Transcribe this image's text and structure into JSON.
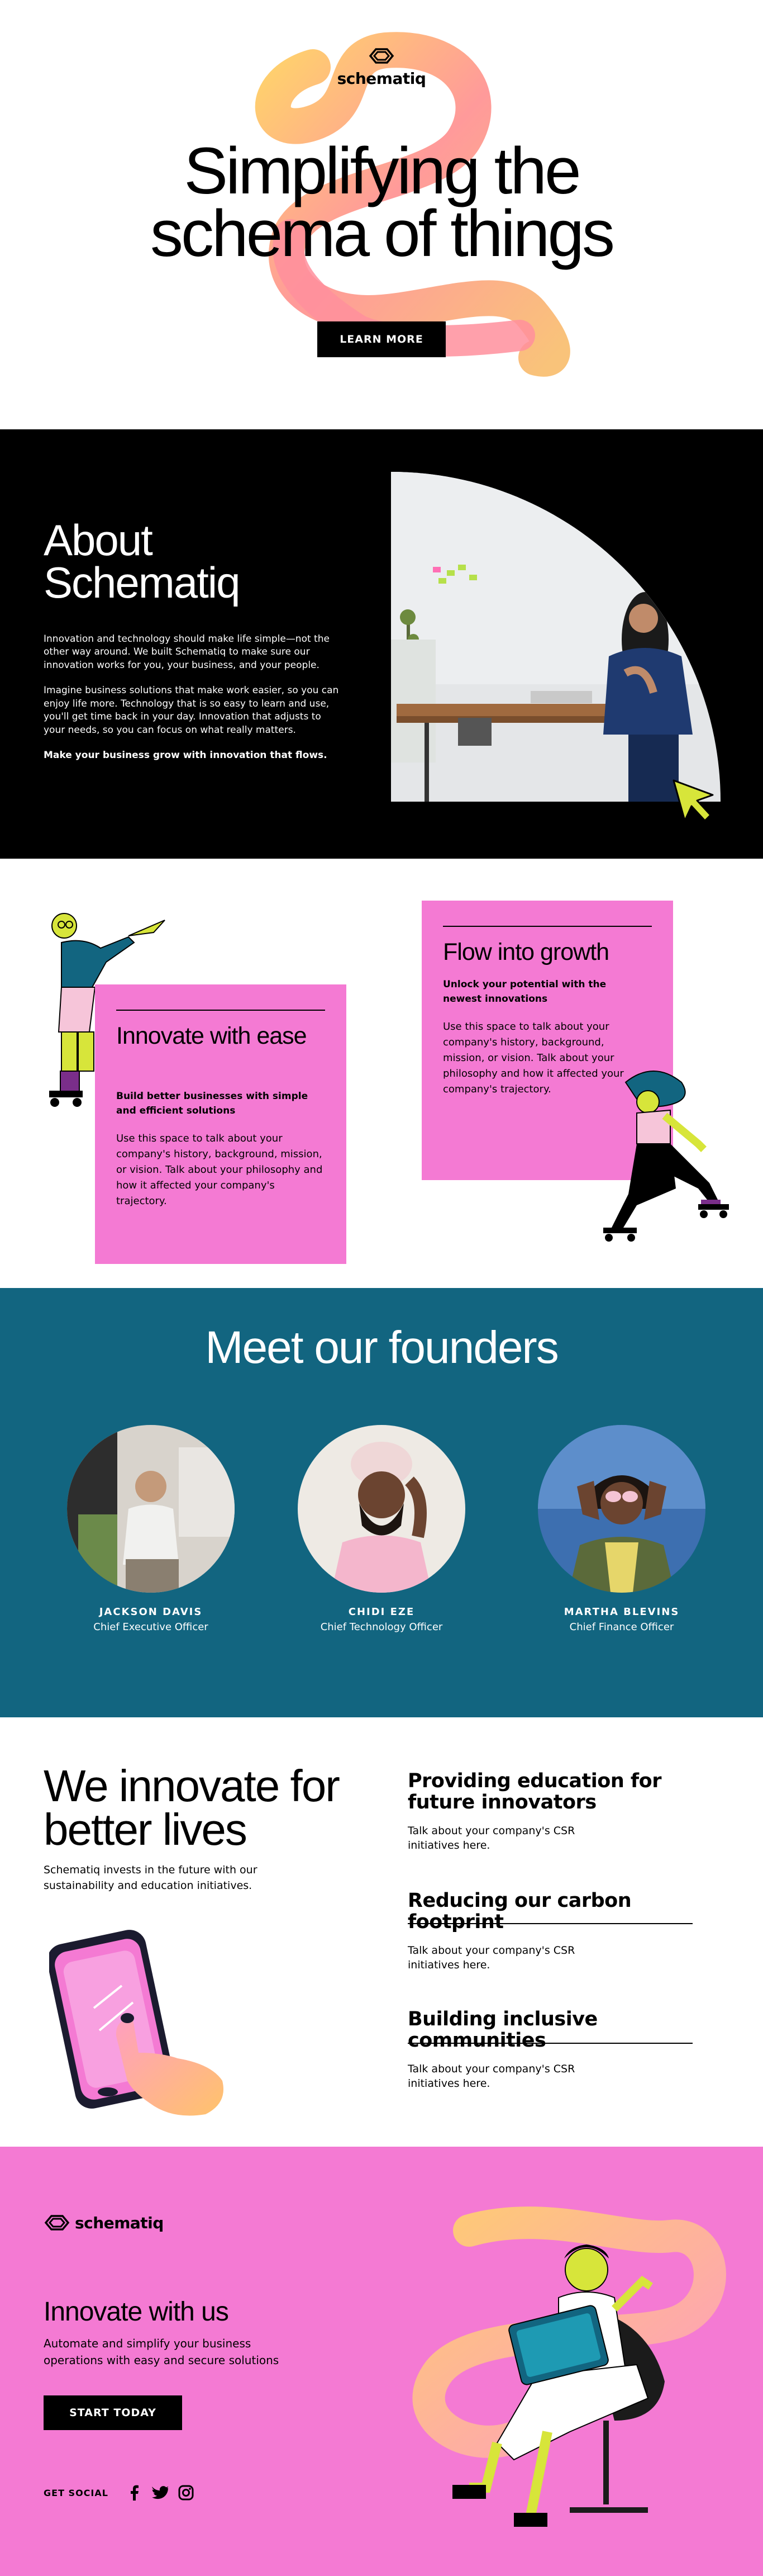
{
  "brand": {
    "name": "schematiq"
  },
  "hero": {
    "title_line1": "Simplifying the",
    "title_line2": "schema of things",
    "cta_label": "LEARN MORE"
  },
  "about": {
    "title": "About Schematiq",
    "paragraph1": "Innovation and technology should make life simple—not the other way around. We built Schematiq to make sure our innovation works for you, your business, and your people.",
    "paragraph2": "Imagine business solutions that make work easier, so you can enjoy life more. Technology that is so easy to learn and use, you'll get time back in your day. Innovation that adjusts to your needs, so you can focus on what really matters.",
    "paragraph3": "Make your business grow with innovation that flows."
  },
  "cards": [
    {
      "title": "Innovate with ease",
      "subtitle": "Build better businesses with simple and efficient solutions",
      "body": "Use this space to talk about your company's history, background, mission, or vision. Talk about your philosophy and how it affected your company's trajectory."
    },
    {
      "title": "Flow into growth",
      "subtitle": "Unlock your potential with the newest innovations",
      "body": "Use this space to talk about your company's history, background, mission, or vision. Talk about your philosophy and how it affected your company's trajectory."
    }
  ],
  "founders": {
    "title": "Meet our founders",
    "people": [
      {
        "name": "JACKSON DAVIS",
        "role": "Chief Executive Officer"
      },
      {
        "name": "CHIDI EZE",
        "role": "Chief Technology Officer"
      },
      {
        "name": "MARTHA BLEVINS",
        "role": "Chief Finance Officer"
      }
    ]
  },
  "csr": {
    "title": "We innovate for better lives",
    "subtitle": "Schematiq invests in the future with our sustainability and education initiatives.",
    "initiatives": [
      {
        "title": "Providing education for future innovators",
        "body": "Talk about your company's CSR initiatives here."
      },
      {
        "title": "Reducing our carbon footprint",
        "body": "Talk about your company's CSR initiatives here."
      },
      {
        "title": "Building inclusive communities",
        "body": "Talk about your company's CSR initiatives here."
      }
    ]
  },
  "cta": {
    "title": "Innovate with us",
    "subtitle": "Automate and simplify your business operations with easy and secure solutions",
    "button": "START TODAY",
    "social_label": "GET SOCIAL",
    "social_icons": [
      "facebook-icon",
      "twitter-icon",
      "instagram-icon"
    ]
  },
  "colors": {
    "pink": "#f47ad3",
    "teal": "#126580",
    "lime": "#d7e53a",
    "black": "#000000"
  }
}
